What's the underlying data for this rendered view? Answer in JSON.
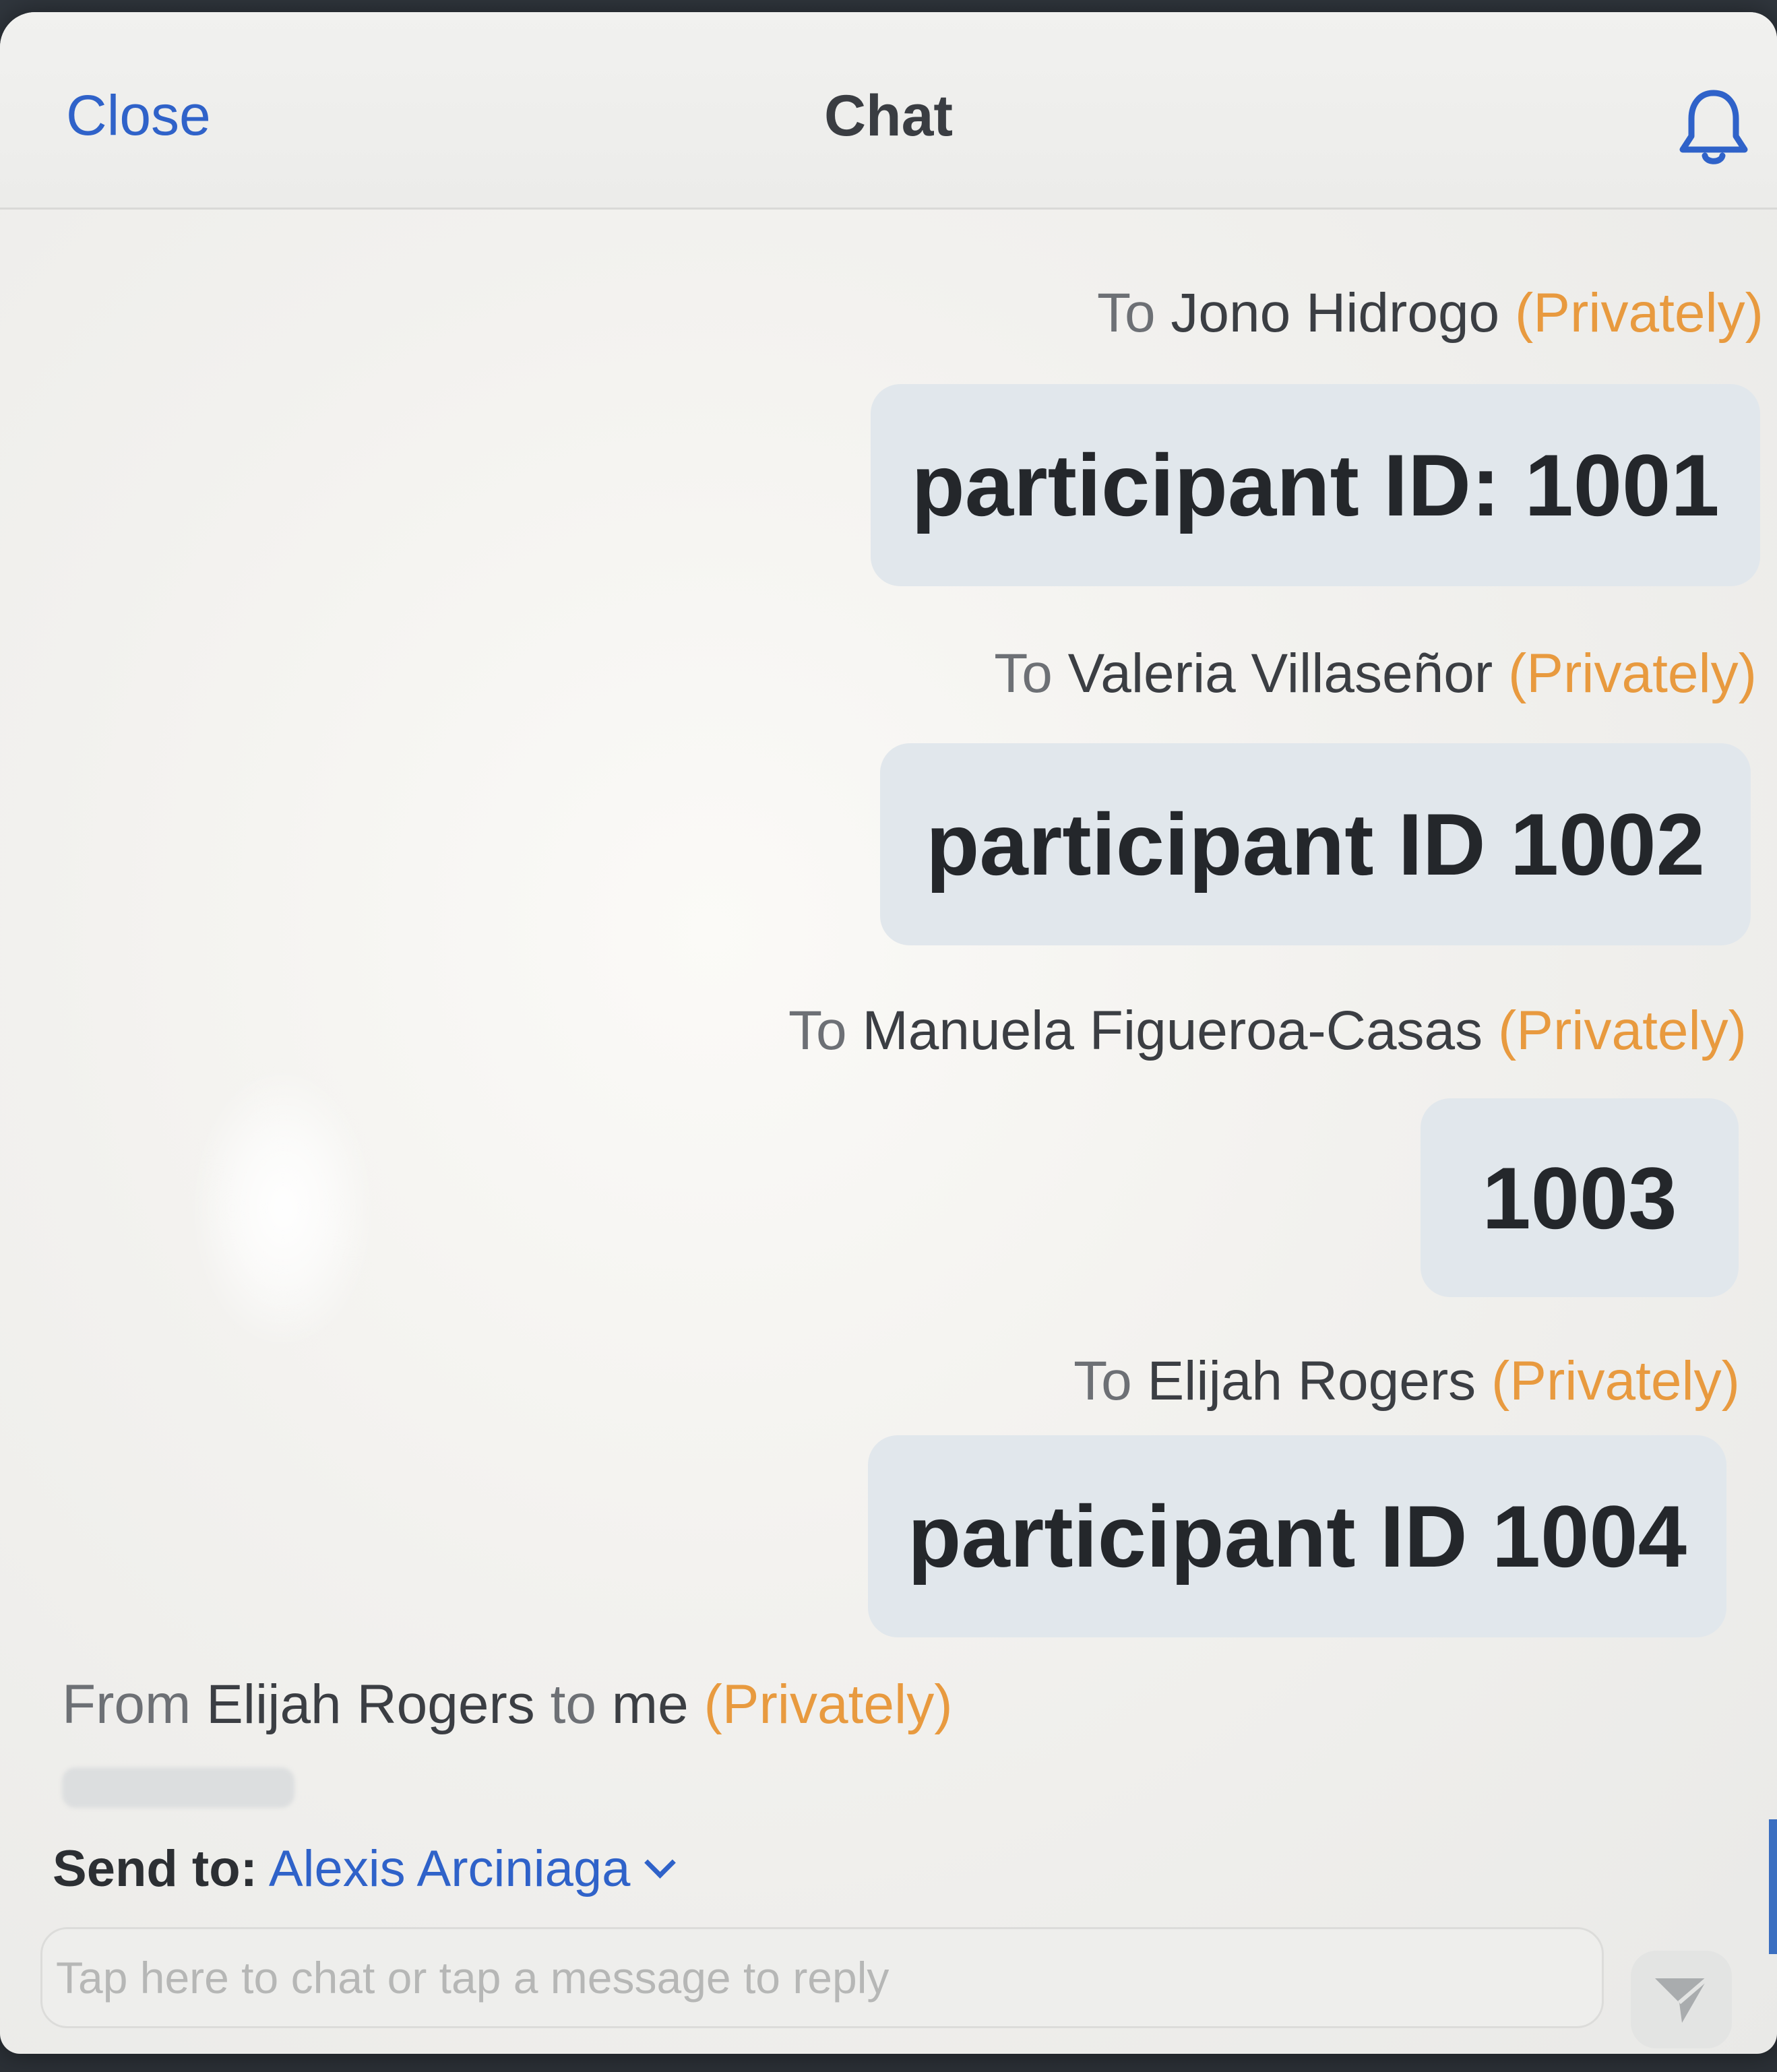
{
  "header": {
    "close_label": "Close",
    "title": "Chat",
    "bell_icon": "bell-icon"
  },
  "messages": [
    {
      "prefix": "To",
      "name": "Jono Hidrogo",
      "privacy": "(Privately)",
      "text": "participant ID: 1001"
    },
    {
      "prefix": "To",
      "name": "Valeria Villaseñor",
      "privacy": "(Privately)",
      "text": "participant ID 1002"
    },
    {
      "prefix": "To",
      "name": "Manuela Figueroa-Casas",
      "privacy": "(Privately)",
      "text": "1003"
    },
    {
      "prefix": "To",
      "name": "Elijah Rogers",
      "privacy": "(Privately)",
      "text": "participant ID 1004"
    }
  ],
  "incoming": {
    "prefix": "From",
    "name": "Elijah Rogers",
    "middle": "to",
    "recipient": "me",
    "privacy": "(Privately)"
  },
  "send_to": {
    "label": "Send to:",
    "target": "Alexis Arciniaga"
  },
  "input": {
    "placeholder": "Tap here to chat or tap a message to reply",
    "value": ""
  },
  "colors": {
    "accent_blue": "#2f62c9",
    "privately_orange": "#e89a3f",
    "bubble_bg": "#e1e7ec"
  },
  "icons": {
    "send": "send-icon",
    "chevron": "chevron-down-icon"
  }
}
